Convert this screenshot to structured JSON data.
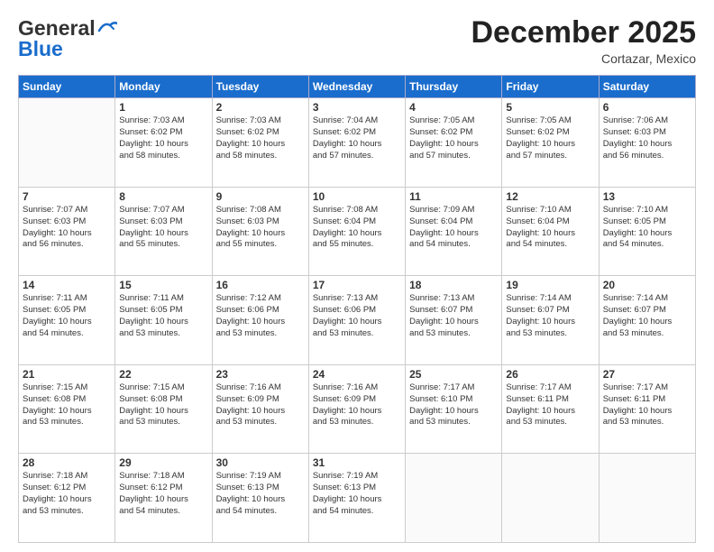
{
  "header": {
    "logo_general": "General",
    "logo_blue": "Blue",
    "month_year": "December 2025",
    "location": "Cortazar, Mexico"
  },
  "days_of_week": [
    "Sunday",
    "Monday",
    "Tuesday",
    "Wednesday",
    "Thursday",
    "Friday",
    "Saturday"
  ],
  "weeks": [
    [
      {
        "day": "",
        "info": ""
      },
      {
        "day": "1",
        "info": "Sunrise: 7:03 AM\nSunset: 6:02 PM\nDaylight: 10 hours\nand 58 minutes."
      },
      {
        "day": "2",
        "info": "Sunrise: 7:03 AM\nSunset: 6:02 PM\nDaylight: 10 hours\nand 58 minutes."
      },
      {
        "day": "3",
        "info": "Sunrise: 7:04 AM\nSunset: 6:02 PM\nDaylight: 10 hours\nand 57 minutes."
      },
      {
        "day": "4",
        "info": "Sunrise: 7:05 AM\nSunset: 6:02 PM\nDaylight: 10 hours\nand 57 minutes."
      },
      {
        "day": "5",
        "info": "Sunrise: 7:05 AM\nSunset: 6:02 PM\nDaylight: 10 hours\nand 57 minutes."
      },
      {
        "day": "6",
        "info": "Sunrise: 7:06 AM\nSunset: 6:03 PM\nDaylight: 10 hours\nand 56 minutes."
      }
    ],
    [
      {
        "day": "7",
        "info": "Sunrise: 7:07 AM\nSunset: 6:03 PM\nDaylight: 10 hours\nand 56 minutes."
      },
      {
        "day": "8",
        "info": "Sunrise: 7:07 AM\nSunset: 6:03 PM\nDaylight: 10 hours\nand 55 minutes."
      },
      {
        "day": "9",
        "info": "Sunrise: 7:08 AM\nSunset: 6:03 PM\nDaylight: 10 hours\nand 55 minutes."
      },
      {
        "day": "10",
        "info": "Sunrise: 7:08 AM\nSunset: 6:04 PM\nDaylight: 10 hours\nand 55 minutes."
      },
      {
        "day": "11",
        "info": "Sunrise: 7:09 AM\nSunset: 6:04 PM\nDaylight: 10 hours\nand 54 minutes."
      },
      {
        "day": "12",
        "info": "Sunrise: 7:10 AM\nSunset: 6:04 PM\nDaylight: 10 hours\nand 54 minutes."
      },
      {
        "day": "13",
        "info": "Sunrise: 7:10 AM\nSunset: 6:05 PM\nDaylight: 10 hours\nand 54 minutes."
      }
    ],
    [
      {
        "day": "14",
        "info": "Sunrise: 7:11 AM\nSunset: 6:05 PM\nDaylight: 10 hours\nand 54 minutes."
      },
      {
        "day": "15",
        "info": "Sunrise: 7:11 AM\nSunset: 6:05 PM\nDaylight: 10 hours\nand 53 minutes."
      },
      {
        "day": "16",
        "info": "Sunrise: 7:12 AM\nSunset: 6:06 PM\nDaylight: 10 hours\nand 53 minutes."
      },
      {
        "day": "17",
        "info": "Sunrise: 7:13 AM\nSunset: 6:06 PM\nDaylight: 10 hours\nand 53 minutes."
      },
      {
        "day": "18",
        "info": "Sunrise: 7:13 AM\nSunset: 6:07 PM\nDaylight: 10 hours\nand 53 minutes."
      },
      {
        "day": "19",
        "info": "Sunrise: 7:14 AM\nSunset: 6:07 PM\nDaylight: 10 hours\nand 53 minutes."
      },
      {
        "day": "20",
        "info": "Sunrise: 7:14 AM\nSunset: 6:07 PM\nDaylight: 10 hours\nand 53 minutes."
      }
    ],
    [
      {
        "day": "21",
        "info": "Sunrise: 7:15 AM\nSunset: 6:08 PM\nDaylight: 10 hours\nand 53 minutes."
      },
      {
        "day": "22",
        "info": "Sunrise: 7:15 AM\nSunset: 6:08 PM\nDaylight: 10 hours\nand 53 minutes."
      },
      {
        "day": "23",
        "info": "Sunrise: 7:16 AM\nSunset: 6:09 PM\nDaylight: 10 hours\nand 53 minutes."
      },
      {
        "day": "24",
        "info": "Sunrise: 7:16 AM\nSunset: 6:09 PM\nDaylight: 10 hours\nand 53 minutes."
      },
      {
        "day": "25",
        "info": "Sunrise: 7:17 AM\nSunset: 6:10 PM\nDaylight: 10 hours\nand 53 minutes."
      },
      {
        "day": "26",
        "info": "Sunrise: 7:17 AM\nSunset: 6:11 PM\nDaylight: 10 hours\nand 53 minutes."
      },
      {
        "day": "27",
        "info": "Sunrise: 7:17 AM\nSunset: 6:11 PM\nDaylight: 10 hours\nand 53 minutes."
      }
    ],
    [
      {
        "day": "28",
        "info": "Sunrise: 7:18 AM\nSunset: 6:12 PM\nDaylight: 10 hours\nand 53 minutes."
      },
      {
        "day": "29",
        "info": "Sunrise: 7:18 AM\nSunset: 6:12 PM\nDaylight: 10 hours\nand 54 minutes."
      },
      {
        "day": "30",
        "info": "Sunrise: 7:19 AM\nSunset: 6:13 PM\nDaylight: 10 hours\nand 54 minutes."
      },
      {
        "day": "31",
        "info": "Sunrise: 7:19 AM\nSunset: 6:13 PM\nDaylight: 10 hours\nand 54 minutes."
      },
      {
        "day": "",
        "info": ""
      },
      {
        "day": "",
        "info": ""
      },
      {
        "day": "",
        "info": ""
      }
    ]
  ]
}
